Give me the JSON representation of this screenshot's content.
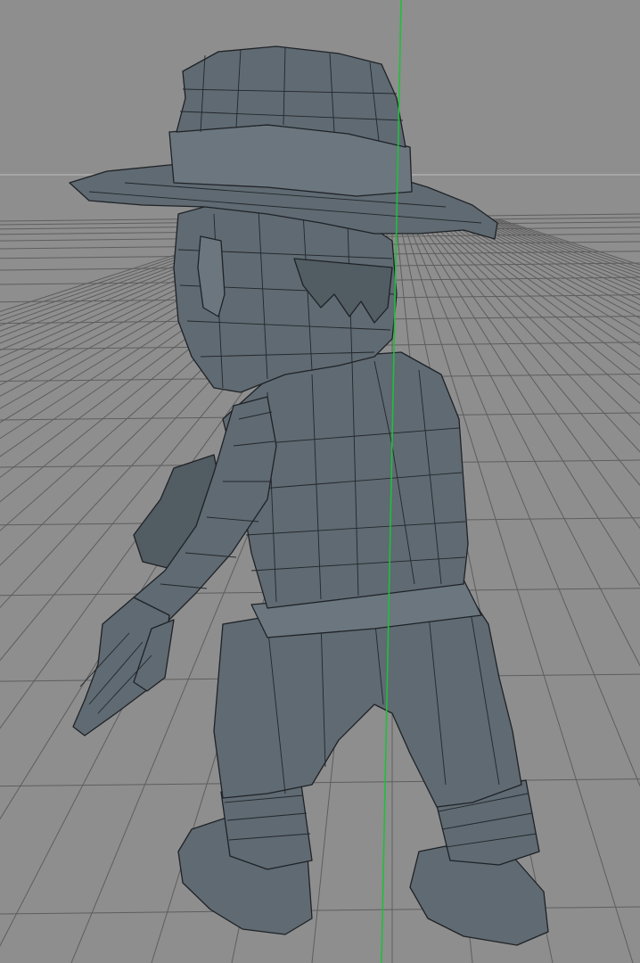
{
  "viewport": {
    "view": "perspective",
    "background_color": "#8e8e8e",
    "grid_color": "#5e5e5e",
    "axis_color": "#1fbf3a",
    "horizon_color": "#b5b5b5",
    "mesh_color": "#5f6a72",
    "wire_color": "#1f2226"
  },
  "model": {
    "display": "wireframe-shaded",
    "parts": [
      "hat-icon",
      "head",
      "torso",
      "left-arm",
      "right-arm",
      "belt",
      "pants",
      "left-boot",
      "right-boot"
    ]
  }
}
